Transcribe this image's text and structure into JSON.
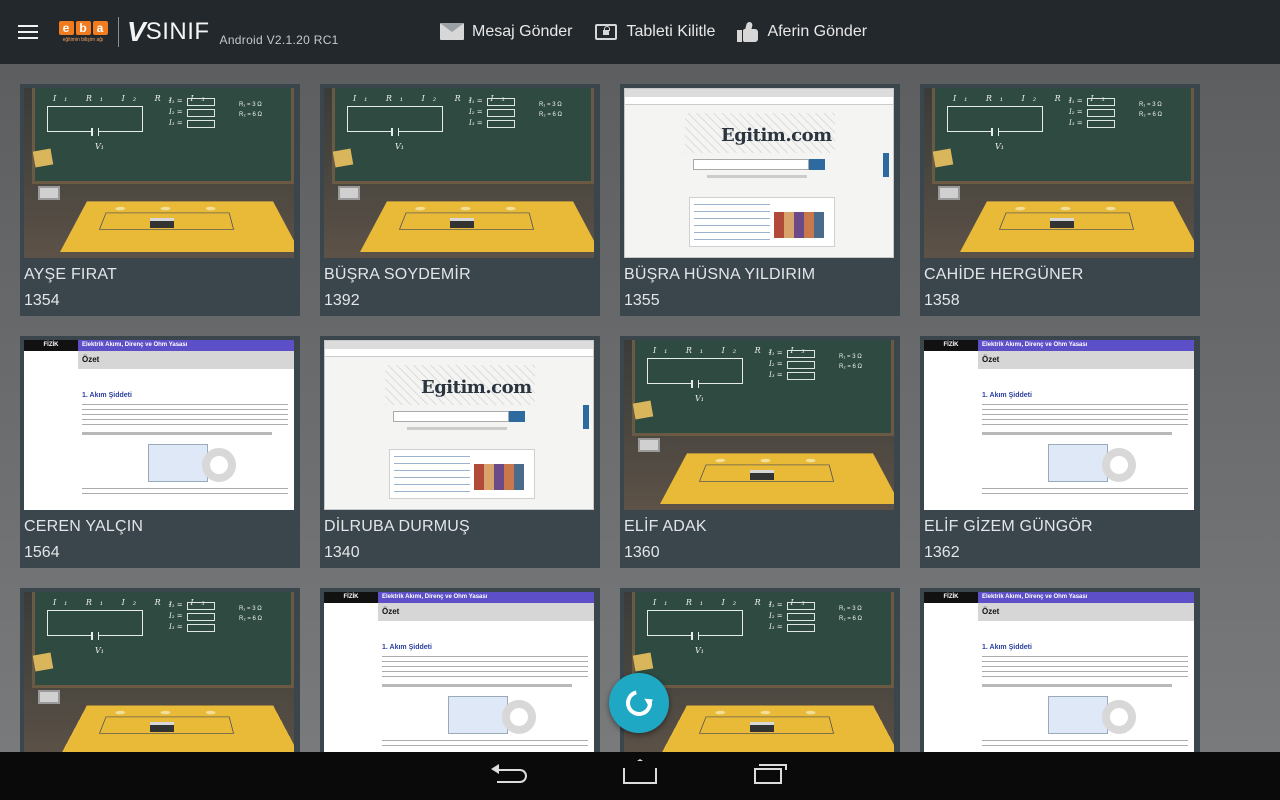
{
  "topbar": {
    "brand_eba": "eba",
    "brand_eba_sub": "eğitimin bilişim ağı",
    "brand_v": "V",
    "brand_sinif": "SINIF",
    "version": "Android V2.1.20 RC1",
    "actions": [
      {
        "label": "Mesaj Gönder",
        "icon": "envelope-icon"
      },
      {
        "label": "Tableti Kilitle",
        "icon": "tablet-lock-icon"
      },
      {
        "label": "Aferin Gönder",
        "icon": "thumbs-up-icon"
      }
    ]
  },
  "students": [
    {
      "name": "AYŞE FIRAT",
      "number": "1354",
      "screen": "simulation"
    },
    {
      "name": "BÜŞRA SOYDEMİR",
      "number": "1392",
      "screen": "simulation"
    },
    {
      "name": "BÜŞRA HÜSNA YILDIRIM",
      "number": "1355",
      "screen": "browser"
    },
    {
      "name": "CAHİDE HERGÜNER",
      "number": "1358",
      "screen": "simulation"
    },
    {
      "name": "CEREN YALÇIN",
      "number": "1564",
      "screen": "document"
    },
    {
      "name": "DİLRUBA DURMUŞ",
      "number": "1340",
      "screen": "browser"
    },
    {
      "name": "ELİF ADAK",
      "number": "1360",
      "screen": "simulation"
    },
    {
      "name": "ELİF GİZEM GÜNGÖR",
      "number": "1362",
      "screen": "document"
    },
    {
      "name": "",
      "number": "",
      "screen": "simulation"
    },
    {
      "name": "",
      "number": "",
      "screen": "document"
    },
    {
      "name": "",
      "number": "",
      "screen": "simulation"
    },
    {
      "name": "",
      "number": "",
      "screen": "document"
    }
  ],
  "screens": {
    "doc_subject": "FİZİK",
    "doc_title": "Elektrik Akımı, Direnç ve Ohm Yasası",
    "doc_section": "Özet",
    "doc_heading": "1. Akım Şiddeti",
    "browser_logo": "Egitim.com",
    "sim_labels": "I₁ R₁ I₂ R₂ I₃",
    "sim_v": "V₁",
    "sim_i_col": "I₁ =\nI₂ =\nI₃ =",
    "sim_r_col": "R₁ = 3 Ω\nR₂ = 6 Ω"
  },
  "fab": {
    "icon": "refresh-icon"
  },
  "navbar": {
    "icons": [
      "back-icon",
      "home-icon",
      "recent-apps-icon"
    ]
  },
  "colors": {
    "accent": "#1fa8c4",
    "topbar": "#23282c",
    "card": "#3a454c",
    "eba_orange": "#f07c1f"
  }
}
